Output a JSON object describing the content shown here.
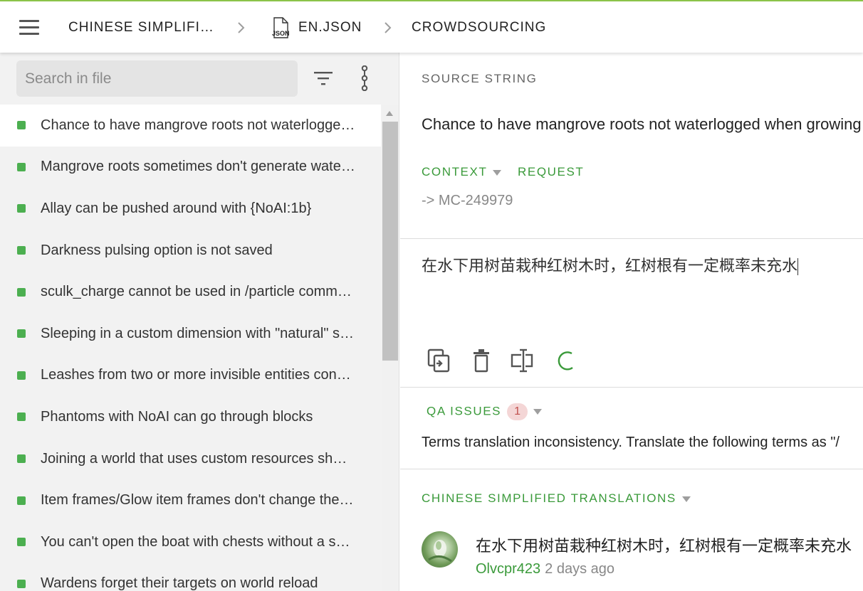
{
  "breadcrumb": {
    "language": "CHINESE SIMPLIFI…",
    "file": "EN.JSON",
    "project": "CROWDSOURCING"
  },
  "icons": {
    "menu": "hamburger-menu-icon",
    "chevron": "chevron-right-icon",
    "file": "json-file-icon",
    "filter": "filter-icon",
    "more": "more-vertical-icon",
    "copy": "copy-source-icon",
    "delete": "delete-icon",
    "tm": "text-cursor-box-icon",
    "loading": "loading-spinner-icon"
  },
  "colors": {
    "accent_green": "#3a9a3a",
    "status_dot": "#4caf50",
    "top_border": "#8bc34a",
    "qa_badge_bg": "#f4d6d6",
    "qa_badge_fg": "#c0504d"
  },
  "search": {
    "placeholder": "Search in file",
    "value": ""
  },
  "strings": [
    {
      "text": "Chance to have mangrove roots not waterlogge…",
      "active": true
    },
    {
      "text": "Mangrove roots sometimes don't generate wate…"
    },
    {
      "text": "Allay can be pushed around with {NoAI:1b}"
    },
    {
      "text": "Darkness pulsing option is not saved"
    },
    {
      "text": "sculk_charge cannot be used in /particle comm…"
    },
    {
      "text": "Sleeping in a custom dimension with \"natural\" s…"
    },
    {
      "text": "Leashes from two or more invisible entities con…"
    },
    {
      "text": "Phantoms with NoAI can go through blocks"
    },
    {
      "text": "Joining a world that uses custom resources sh…"
    },
    {
      "text": "Item frames/Glow item frames don't change the…"
    },
    {
      "text": "You can't open the boat with chests without a s…"
    },
    {
      "text": "Wardens forget their targets on world reload"
    }
  ],
  "source": {
    "label": "SOURCE STRING",
    "text": "Chance to have mangrove roots not waterlogged when growing",
    "context_label": "CONTEXT",
    "request_label": "REQUEST",
    "context_value": "-> MC-249979"
  },
  "editor": {
    "value": "在水下用树苗栽种红树木时，红树根有一定概率未充水"
  },
  "qa": {
    "label": "QA ISSUES",
    "count": "1",
    "message": "Terms translation inconsistency. Translate the following terms as \"/"
  },
  "translations": {
    "label": "CHINESE SIMPLIFIED TRANSLATIONS",
    "items": [
      {
        "text": "在水下用树苗栽种红树木时，红树根有一定概率未充水",
        "user": "Olvcpr423",
        "time": "2 days ago"
      }
    ]
  }
}
